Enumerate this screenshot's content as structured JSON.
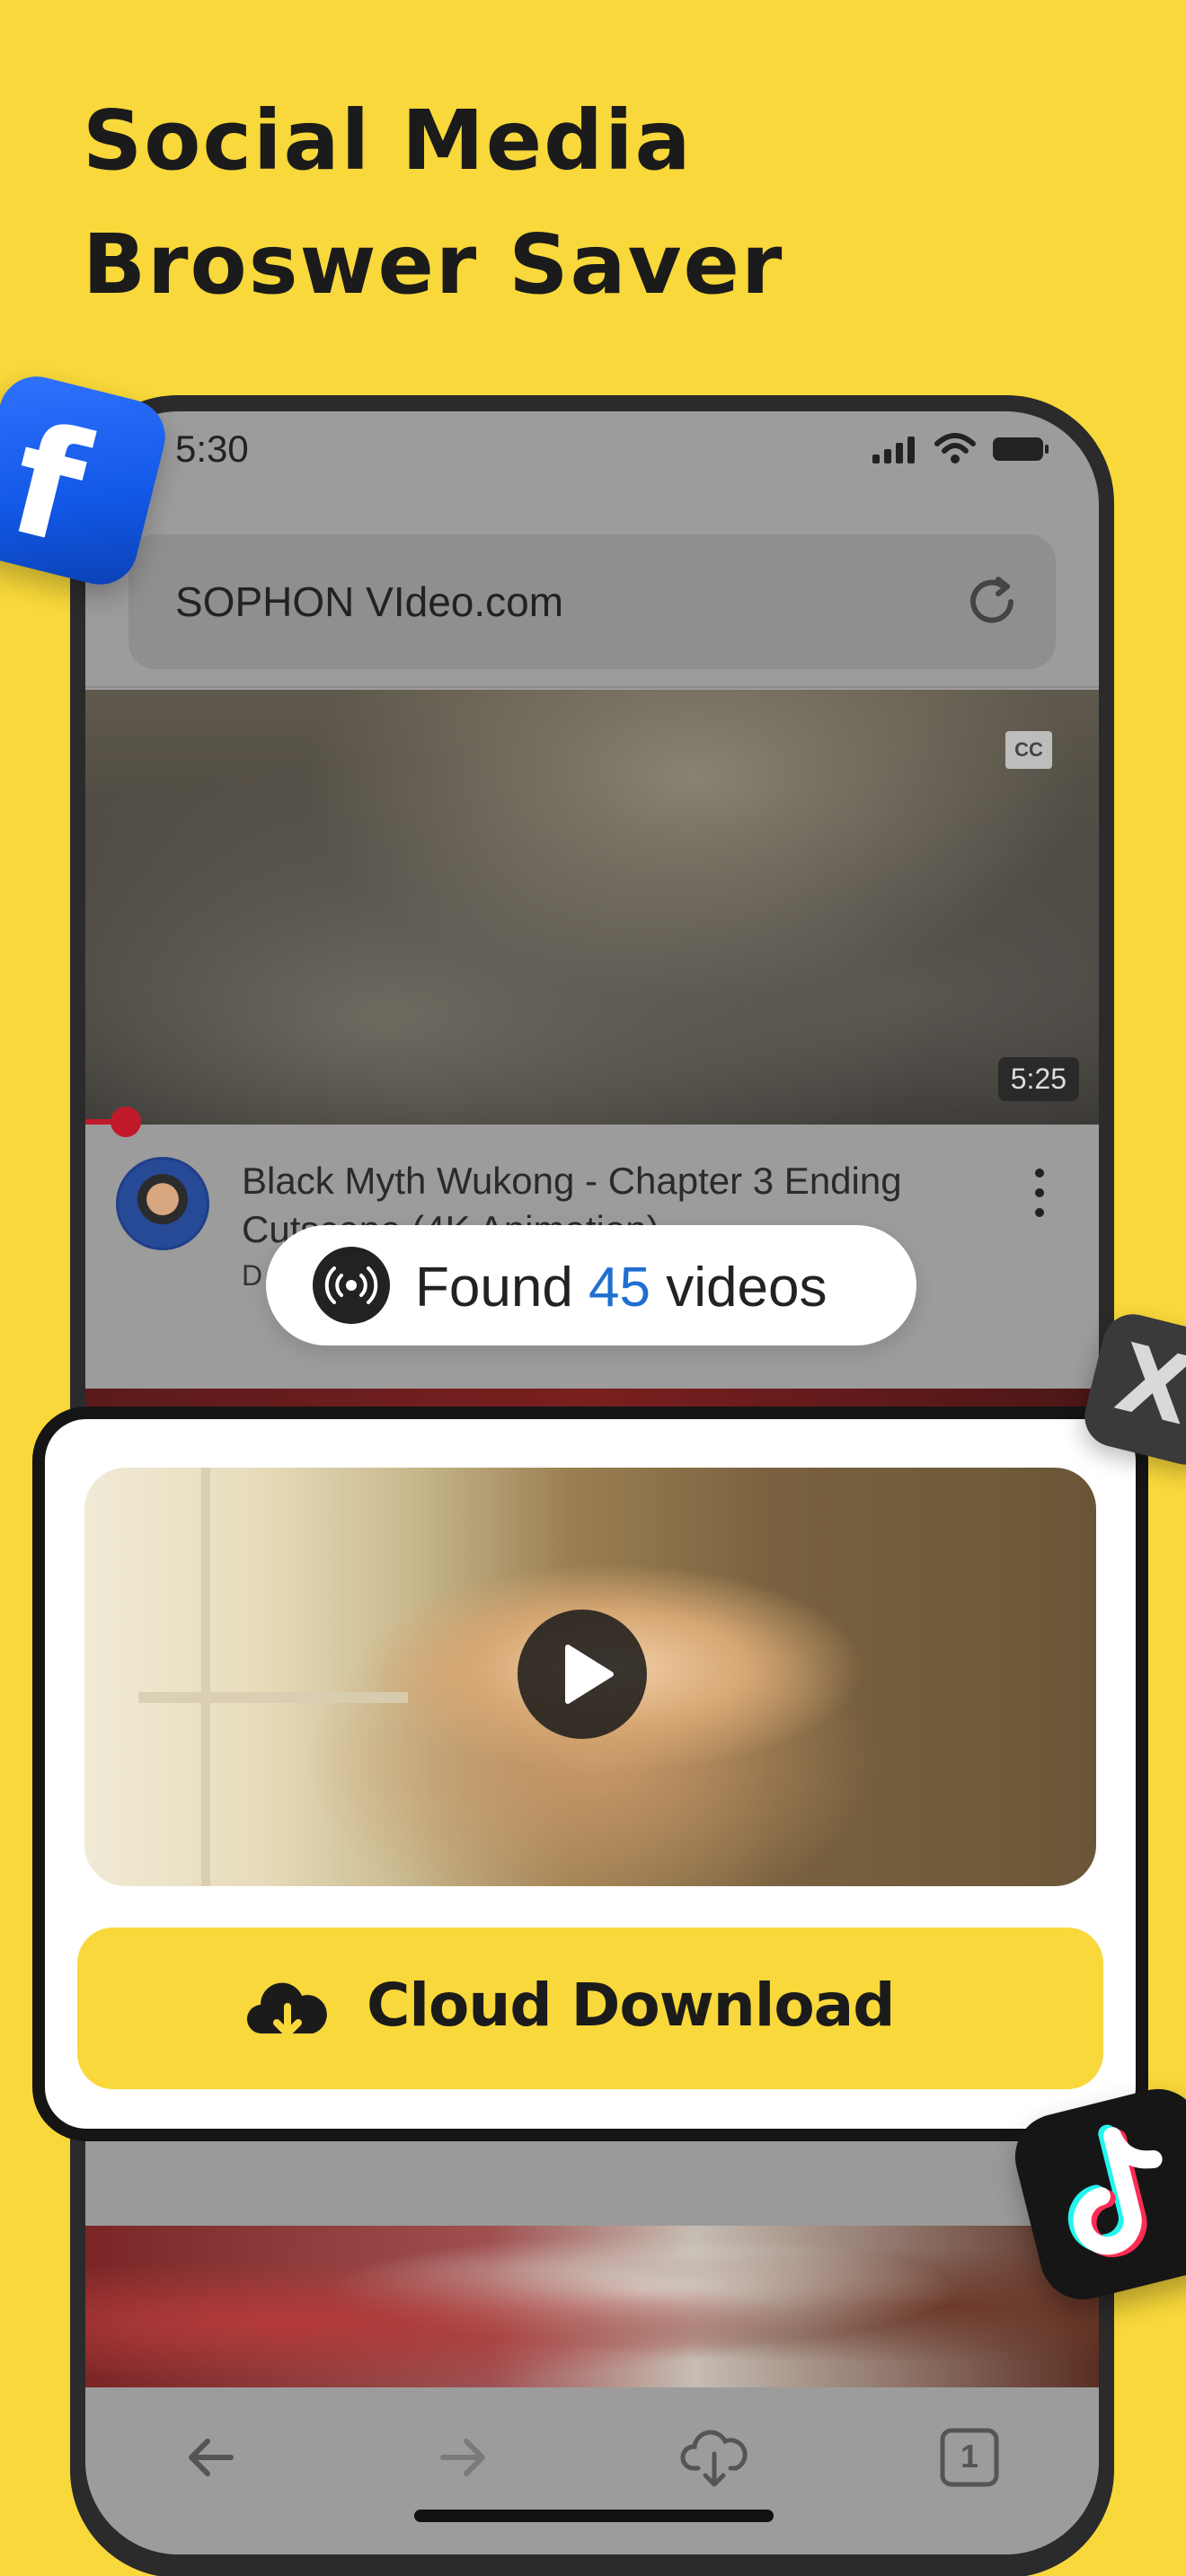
{
  "headline": {
    "line1": "Social Media",
    "line2": "Broswer Saver"
  },
  "status_bar": {
    "time": "5:30"
  },
  "browser": {
    "url": "SOPHON VIdeo.com"
  },
  "video": {
    "cc_label": "CC",
    "duration": "5:25",
    "title": "Black Myth Wukong - Chapter 3 Ending Cutscene (4K Animation)",
    "channel_initial": "D"
  },
  "found_banner": {
    "prefix": "Found",
    "count": "45",
    "suffix": "videos"
  },
  "download_card": {
    "button_label": "Cloud Download"
  },
  "toolbar": {
    "tab_count": "1"
  },
  "colors": {
    "background": "#f8d83a",
    "accent_blue": "#1f6fd0",
    "button_yellow": "#f8d83a"
  },
  "icons": [
    "facebook-icon",
    "x-icon",
    "tiktok-icon",
    "refresh-icon",
    "broadcast-icon",
    "play-icon",
    "cloud-download-icon",
    "back-icon",
    "forward-icon",
    "tabs-icon"
  ]
}
